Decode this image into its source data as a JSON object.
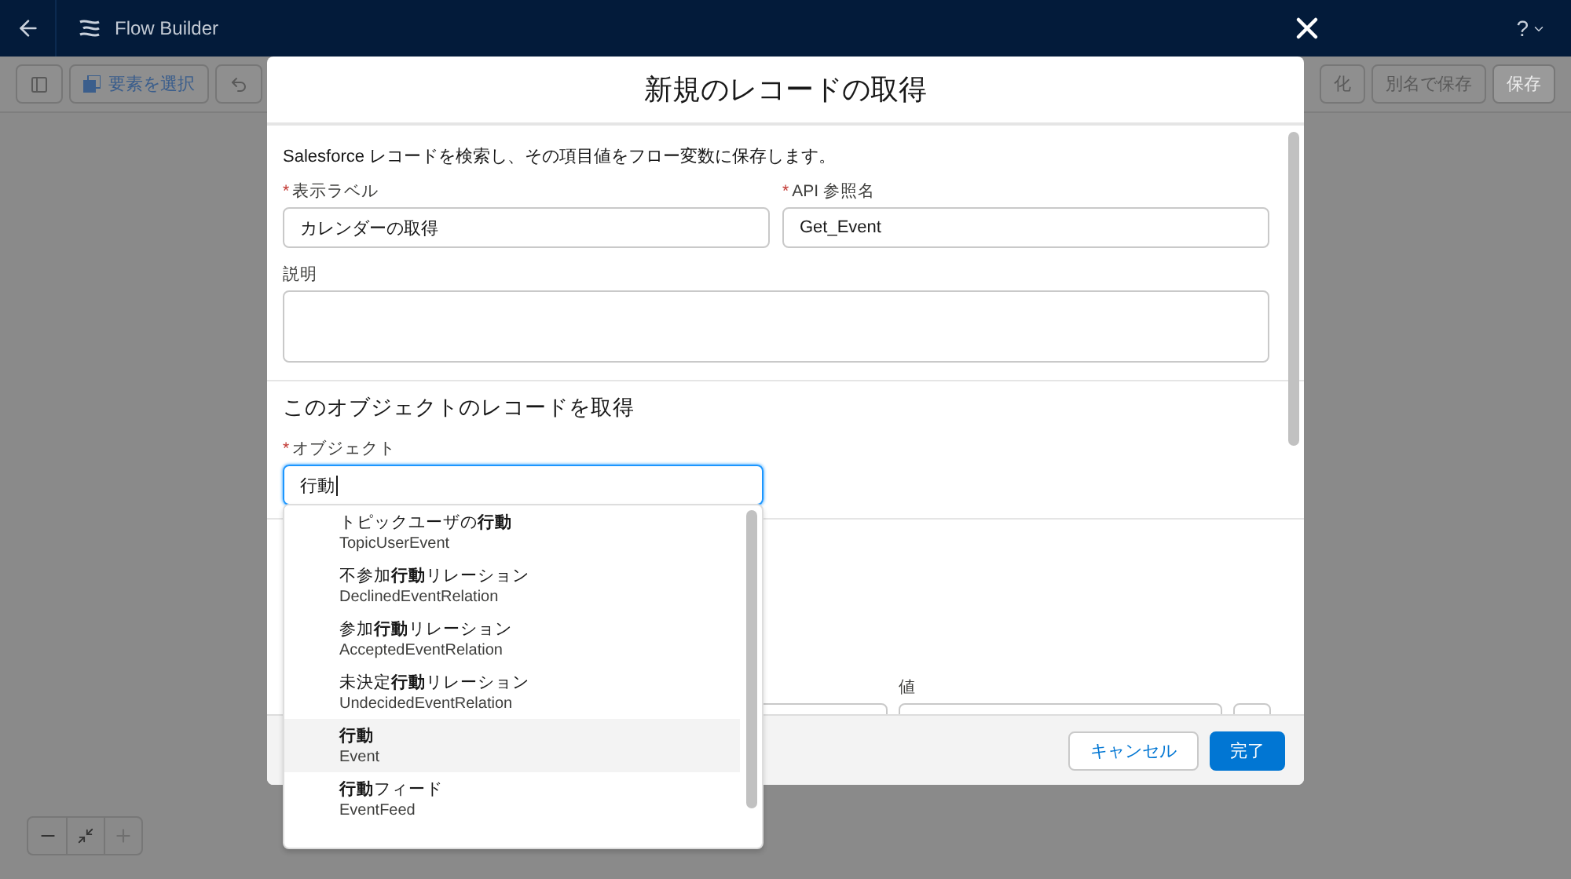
{
  "app": {
    "title": "Flow Builder",
    "help": "?"
  },
  "toolbar": {
    "select_button": "要素を選択",
    "right_buttons": [
      {
        "label": "化",
        "kind": "outline"
      },
      {
        "label": "別名で保存",
        "kind": "outline"
      },
      {
        "label": "保存",
        "kind": "filled"
      }
    ]
  },
  "modal": {
    "required_mark": "*",
    "title": "新規のレコードの取得",
    "description": "Salesforce レコードを検索し、その項目値をフロー変数に保存します。",
    "fields": [
      {
        "label": "表示ラベル",
        "required": true,
        "value": "カレンダーの取得"
      },
      {
        "label": "API 参照名",
        "required": true,
        "value": "Get_Event"
      }
    ],
    "description_field": {
      "label": "説明",
      "required": false
    },
    "section_title": "このオブジェクトのレコードを取得",
    "object_field": {
      "label": "オブジェクト",
      "required": true,
      "value": "行動"
    },
    "filter": {
      "value_label": "値"
    },
    "buttons": [
      {
        "label": "キャンセル",
        "kind": "neutral"
      },
      {
        "label": "完了",
        "kind": "brand"
      }
    ]
  },
  "dropdown": {
    "items": [
      {
        "label": "トピックユーザの**行動**",
        "api_name": "TopicUserEvent",
        "selected": false
      },
      {
        "label": "不参加**行動**リレーション",
        "api_name": "DeclinedEventRelation",
        "selected": false
      },
      {
        "label": "参加**行動**リレーション",
        "api_name": "AcceptedEventRelation",
        "selected": false
      },
      {
        "label": "未決定**行動**リレーション",
        "api_name": "UndecidedEventRelation",
        "selected": false
      },
      {
        "label": "**行動**",
        "api_name": "Event",
        "selected": true
      },
      {
        "label": "**行動**フィード",
        "api_name": "EventFeed",
        "selected": false
      }
    ]
  }
}
